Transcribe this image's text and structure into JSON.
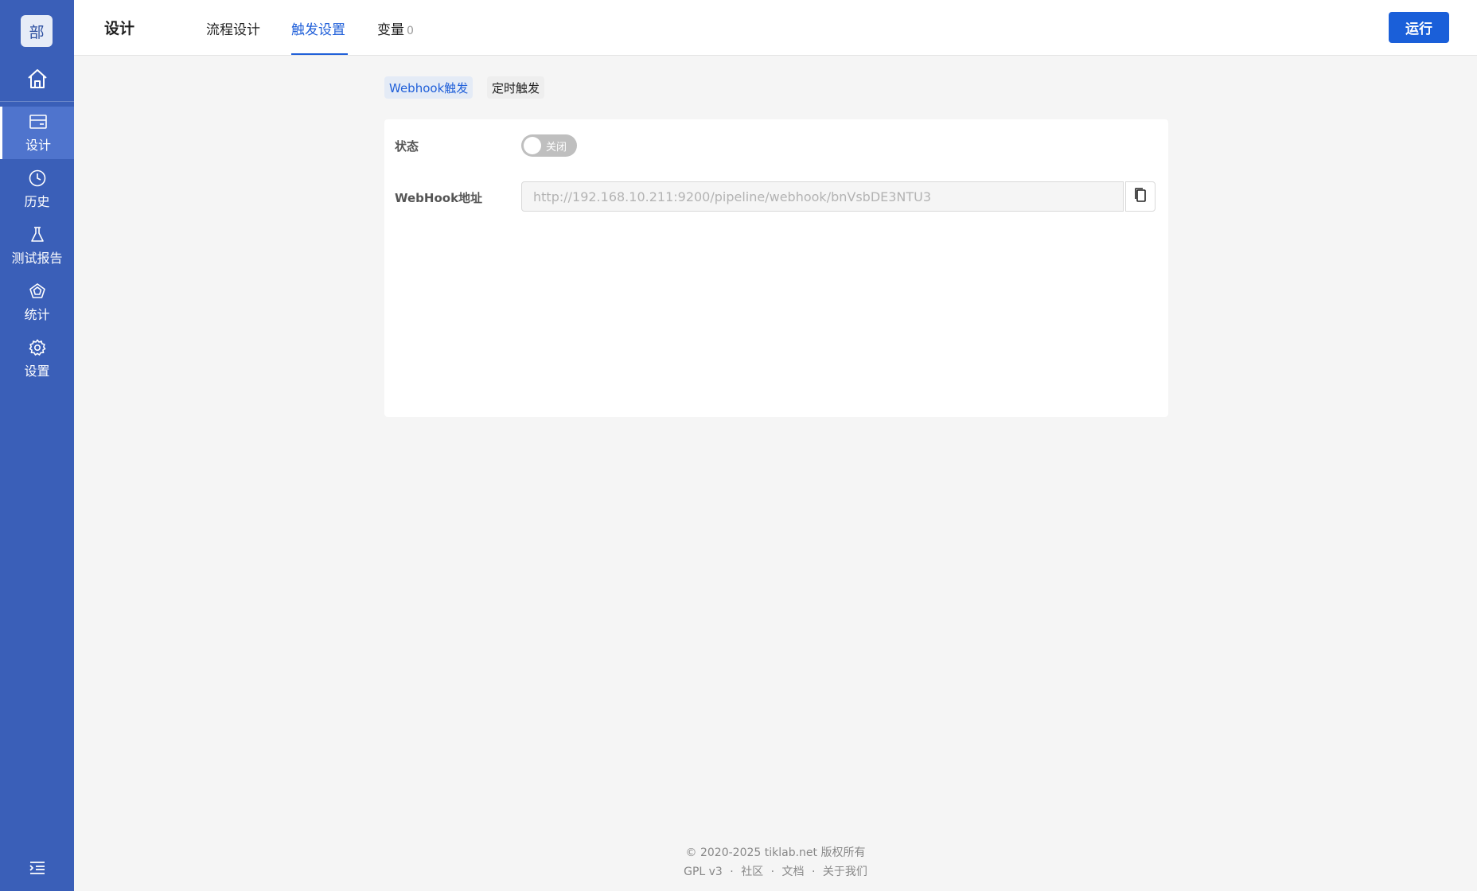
{
  "sidebar": {
    "logo_text": "部",
    "items": [
      {
        "label": "设计",
        "icon": "card-icon"
      },
      {
        "label": "历史",
        "icon": "clock-icon"
      },
      {
        "label": "测试报告",
        "icon": "flask-icon"
      },
      {
        "label": "统计",
        "icon": "pentagon-icon"
      },
      {
        "label": "设置",
        "icon": "gear-icon"
      }
    ],
    "active_color": "#4f74cd",
    "bg_color": "#3a5fb8"
  },
  "header": {
    "title": "设计",
    "tabs": [
      {
        "label": "流程设计"
      },
      {
        "label": "触发设置",
        "active": true
      },
      {
        "label": "变量",
        "count": "0"
      }
    ],
    "run_label": "运行"
  },
  "trigger": {
    "subtabs": [
      {
        "label": "Webhook触发",
        "active": true
      },
      {
        "label": "定时触发"
      }
    ],
    "status_label": "状态",
    "toggle_text": "关闭",
    "webhook_label": "WebHook地址",
    "webhook_url": "http://192.168.10.211:9200/pipeline/webhook/bnVsbDE3NTU3"
  },
  "footer": {
    "copyright": "© 2020-2025 tiklab.net 版权所有",
    "links": [
      "GPL v3",
      "社区",
      "文档",
      "关于我们"
    ],
    "separator": "·"
  },
  "colors": {
    "accent": "#2160d9",
    "run_button": "#1a5fd9"
  }
}
